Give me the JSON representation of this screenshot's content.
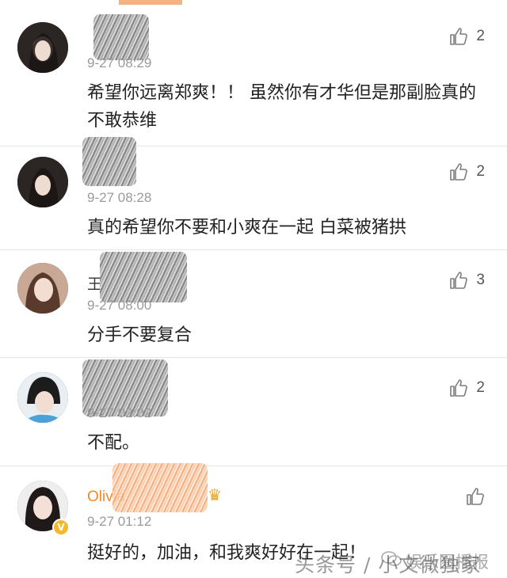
{
  "comments": [
    {
      "username": "",
      "timestamp": "9-27 08:29",
      "text": "希望你远离郑爽！！ 虽然你有才华但是那副脸真的不敢恭维",
      "likes": "2"
    },
    {
      "username": "",
      "timestamp": "9-27 08:28",
      "text": "真的希望你不要和小爽在一起 白菜被猪拱",
      "likes": "2"
    },
    {
      "username": "王",
      "timestamp": "9-27 08:00",
      "text": "分手不要复合",
      "likes": "3"
    },
    {
      "username": "",
      "timestamp": "9-27 02:02",
      "text": "不配。",
      "likes": "2"
    },
    {
      "username": "Olivia",
      "timestamp": "9-27 01:12",
      "text": "挺好的，加油，和我爽好好在一起！",
      "likes": ""
    }
  ],
  "watermark": {
    "left": "头条号 / 小文微独家",
    "right": "娱乐圈播报"
  },
  "icons": {
    "like": "thumbs-up-icon",
    "verified": "verified-badge-icon",
    "vip": "crown-icon",
    "wechat": "wechat-icon"
  },
  "colors": {
    "accent_orange": "#f08a2a",
    "badge_gold": "#f6b72b",
    "divider": "#e6e6e6"
  }
}
